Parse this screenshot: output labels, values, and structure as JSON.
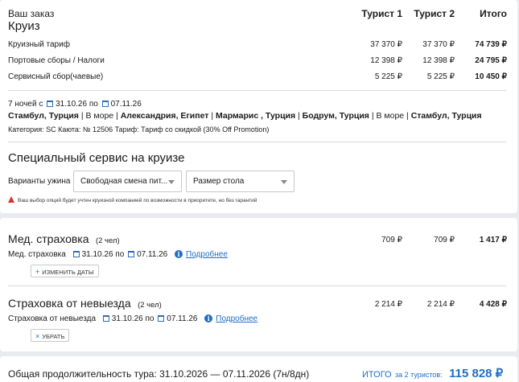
{
  "order": {
    "title": "Ваш заказ",
    "subtitle": "Круиз",
    "columns": [
      "Турист 1",
      "Турист 2",
      "Итого"
    ],
    "rows": [
      {
        "label": "Круизный тариф",
        "t1": "37 370 ₽",
        "t2": "37 370 ₽",
        "total": "74 739 ₽"
      },
      {
        "label": "Портовые сборы / Налоги",
        "t1": "12 398 ₽",
        "t2": "12 398 ₽",
        "total": "24 795 ₽"
      },
      {
        "label": "Сервисный сбор(чаевые)",
        "t1": "5 225 ₽",
        "t2": "5 225 ₽",
        "total": "10 450 ₽"
      }
    ]
  },
  "cruise": {
    "nights": "7 ночей с",
    "date_from": "31.10.26",
    "by": "по",
    "date_to": "07.11.26",
    "route": [
      {
        "text": "Стамбул, Турция",
        "bold": true
      },
      {
        "text": " | ",
        "bold": false
      },
      {
        "text": "В море",
        "bold": false
      },
      {
        "text": " | ",
        "bold": false
      },
      {
        "text": "Александрия, Египет",
        "bold": true
      },
      {
        "text": " | ",
        "bold": false
      },
      {
        "text": "Мармарис , Турция",
        "bold": true
      },
      {
        "text": " | ",
        "bold": false
      },
      {
        "text": "Бодрум, Турция",
        "bold": true
      },
      {
        "text": " | ",
        "bold": false
      },
      {
        "text": "В море",
        "bold": false
      },
      {
        "text": " | ",
        "bold": false
      },
      {
        "text": "Стамбул, Турция",
        "bold": true
      }
    ],
    "details": "Категория: SC  Каюта: № 12506  Тариф: Тариф со скидкой (30% Off Promotion)"
  },
  "special": {
    "title": "Специальный сервис на круизе",
    "dinner_label": "Варианты ужина",
    "dinner_value": "Свободная смена пит...",
    "table_value": "Размер стола",
    "warning": "Ваш выбор опций будет учтен круизной компанией по возможности в приоритете, но без гарантий"
  },
  "medical": {
    "title": "Мед. страховка",
    "count": "(2 чел)",
    "t1": "709 ₽",
    "t2": "709 ₽",
    "total": "1 417 ₽",
    "sub_label": "Мед. страховка",
    "date_from": "31.10.26",
    "by": "по",
    "date_to": "07.11.26",
    "more": "Подробнее",
    "button": "ИЗМЕНИТЬ ДАТЫ"
  },
  "cancel_ins": {
    "title": "Страховка от невыезда",
    "count": "(2 чел)",
    "t1": "2 214 ₽",
    "t2": "2 214 ₽",
    "total": "4 428 ₽",
    "sub_label": "Страховка от невыезда",
    "date_from": "31.10.26",
    "by": "по",
    "date_to": "07.11.26",
    "more": "Подробнее",
    "button": "УБРАТЬ"
  },
  "footer": {
    "duration": "Общая продолжительность тура: 31.10.2026 — 07.11.2026 (7н/8дн)",
    "total_label": "ИТОГО",
    "total_for": "за 2 туристов:",
    "total_value": "115 828 ₽"
  },
  "colors": {
    "accent": "#1f6fc5",
    "warning": "#d8322a",
    "background": "#e9ebee"
  }
}
